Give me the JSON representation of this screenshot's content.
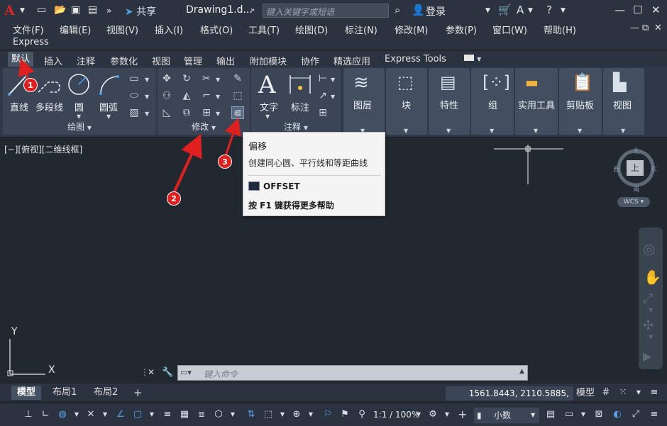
{
  "titlebar": {
    "logo": "A",
    "share": "共享",
    "document": "Drawing1.d...",
    "search_placeholder": "键入关键字或短语",
    "login": "登录"
  },
  "menu": {
    "items": [
      "文件(F)",
      "编辑(E)",
      "视图(V)",
      "插入(I)",
      "格式(O)",
      "工具(T)",
      "绘图(D)",
      "标注(N)",
      "修改(M)",
      "参数(P)",
      "窗口(W)",
      "帮助(H)"
    ],
    "express": "Express"
  },
  "tabs": [
    "默认",
    "插入",
    "注释",
    "参数化",
    "视图",
    "管理",
    "输出",
    "附加模块",
    "协作",
    "精选应用",
    "Express Tools"
  ],
  "ribbon": {
    "draw": {
      "title": "绘图",
      "line": "直线",
      "polyline": "多段线",
      "circle": "圆",
      "arc": "圆弧"
    },
    "modify": {
      "title": "修改"
    },
    "annotation": {
      "title": "注释",
      "text": "文字",
      "dimension": "标注"
    },
    "layers": "图层",
    "block": "块",
    "properties": "特性",
    "groups": "组",
    "utilities": "实用工具",
    "clipboard": "剪贴板",
    "view": "视图"
  },
  "viewport": {
    "label": "[−][俯视][二维线框]",
    "viewcube": {
      "north": "北",
      "south": "南",
      "east": "东",
      "west": "西",
      "top": "上",
      "wcs": "WCS"
    },
    "ucs_x": "X",
    "ucs_y": "Y"
  },
  "tooltip": {
    "title": "偏移",
    "description": "创建同心圆、平行线和等距曲线",
    "command": "OFFSET",
    "help": "按 F1 键获得更多帮助"
  },
  "markers": [
    "1",
    "2",
    "3"
  ],
  "command_line": {
    "placeholder": "键入命令"
  },
  "layout_tabs": [
    "模型",
    "布局1",
    "布局2"
  ],
  "status": {
    "coordinates": "1561.8443, 2110.5885, 0.0000",
    "model": "模型",
    "scale": "1:1 / 100%",
    "units": "小数"
  },
  "colors": {
    "accent_red": "#e01f1f",
    "logo_red": "#e02424",
    "canvas_bg": "#212830",
    "panel_bg": "#3b4556"
  }
}
